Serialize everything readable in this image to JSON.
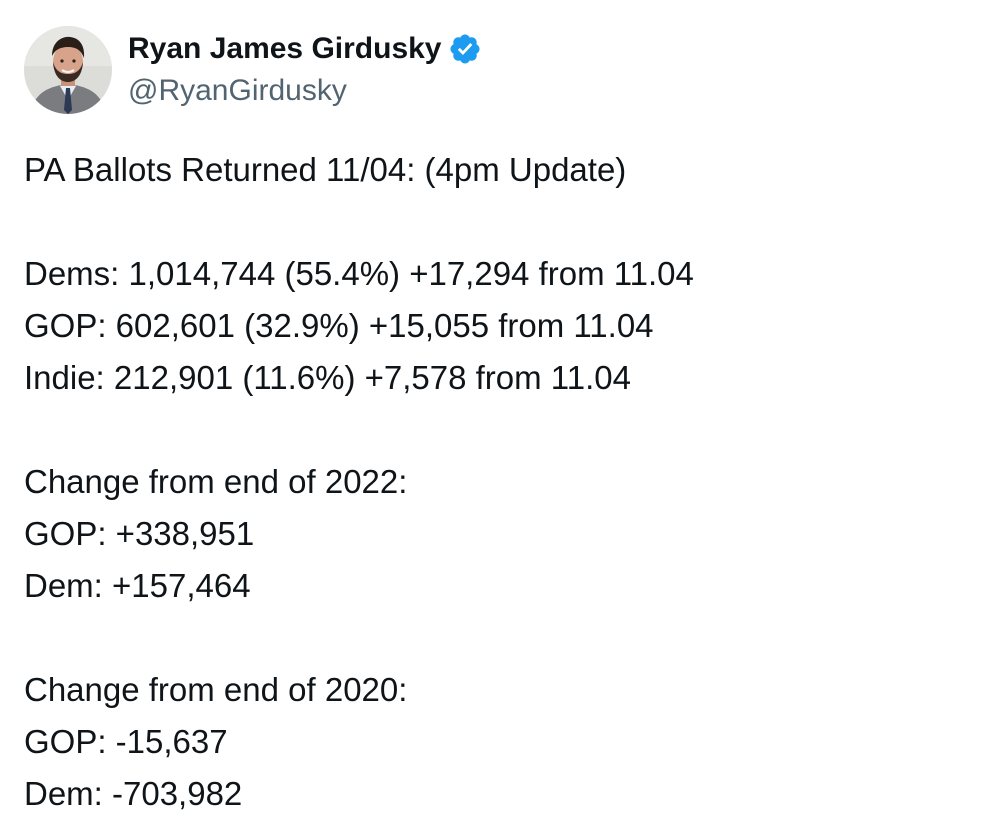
{
  "author": {
    "display_name": "Ryan James Girdusky",
    "handle": "@RyanGirdusky",
    "verified": true,
    "avatar_icon": "profile-photo-avatar",
    "verified_icon": "verified-badge-icon",
    "verified_color": "#1d9bf0"
  },
  "tweet": {
    "lines": [
      "PA Ballots Returned 11/04: (4pm Update)",
      "",
      "Dems: 1,014,744 (55.4%) +17,294 from 11.04",
      "GOP: 602,601 (32.9%) +15,055 from 11.04",
      "Indie: 212,901 (11.6%) +7,578 from 11.04",
      "",
      "Change from end of 2022:",
      "GOP: +338,951",
      "Dem: +157,464",
      "",
      "Change from end of 2020:",
      "GOP: -15,637",
      "Dem: -703,982"
    ]
  },
  "colors": {
    "text_primary": "#0f1419",
    "text_secondary": "#536471",
    "background": "#ffffff"
  }
}
